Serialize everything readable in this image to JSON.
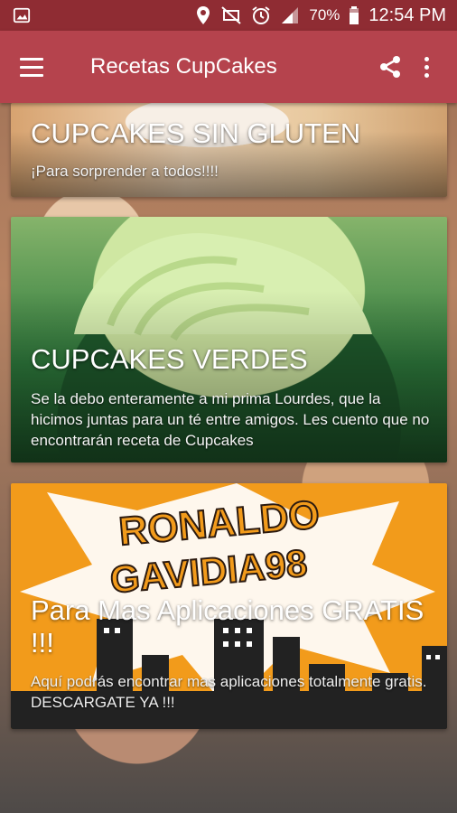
{
  "status_bar": {
    "battery": "70%",
    "time": "12:54 PM"
  },
  "app_bar": {
    "title": "Recetas CupCakes"
  },
  "cards": [
    {
      "title": "CUPCAKES SIN GLUTEN",
      "description": "¡Para sorprender a todos!!!!"
    },
    {
      "title": "CUPCAKES VERDES",
      "description": "Se la debo enteramente a mi prima Lourdes, que la hicimos juntas para un té entre amigos. Les cuento que no encontrarán receta de Cupcakes"
    },
    {
      "title": "Para Mas Aplicaciones GRATIS !!!",
      "description": "Aquí podrás encontrar mas aplicaciones totalmente gratis. DESCARGATE YA !!!",
      "banner_line1": "RONALDO",
      "banner_line2": "GAVIDIA98"
    }
  ],
  "colors": {
    "status_bar": "#8f2c33",
    "app_bar": "#b5434d",
    "promo_orange": "#f29b1b"
  },
  "icons": [
    "image-icon",
    "location-icon",
    "mute-icon",
    "alarm-icon",
    "signal-icon",
    "battery-icon",
    "menu-icon",
    "share-icon",
    "more-vert-icon"
  ]
}
